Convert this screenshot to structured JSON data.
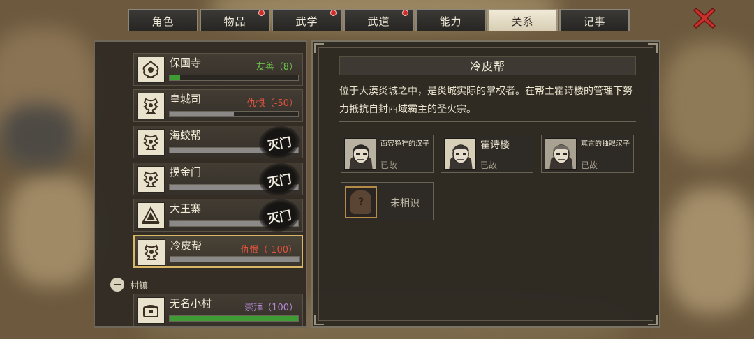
{
  "tabs": [
    {
      "label": "角色",
      "badge": false,
      "active": false
    },
    {
      "label": "物品",
      "badge": true,
      "active": false
    },
    {
      "label": "武学",
      "badge": true,
      "active": false
    },
    {
      "label": "武道",
      "badge": true,
      "active": false
    },
    {
      "label": "能力",
      "badge": false,
      "active": false
    },
    {
      "label": "关系",
      "badge": false,
      "active": true
    },
    {
      "label": "记事",
      "badge": false,
      "active": false
    }
  ],
  "factions": [
    {
      "name": "保国寺",
      "status": "友善（8）",
      "status_color": "#6cbf4a",
      "bar_fill": 0.08,
      "bar_color": "#3f9b34",
      "destroyed": false,
      "selected": false
    },
    {
      "name": "皇城司",
      "status": "仇恨（-50）",
      "status_color": "#e0533f",
      "bar_fill": 0.5,
      "bar_color": "#8b8a88",
      "destroyed": false,
      "selected": false
    },
    {
      "name": "海蛟帮",
      "status": "",
      "status_color": "#e0533f",
      "bar_fill": 1.0,
      "bar_color": "#8b8a88",
      "destroyed": true,
      "selected": false
    },
    {
      "name": "摸金门",
      "status": "",
      "status_color": "#e0533f",
      "bar_fill": 1.0,
      "bar_color": "#8b8a88",
      "destroyed": true,
      "selected": false
    },
    {
      "name": "大王寨",
      "status": "",
      "status_color": "#e0533f",
      "bar_fill": 1.0,
      "bar_color": "#8b8a88",
      "destroyed": true,
      "selected": false
    },
    {
      "name": "冷皮帮",
      "status": "仇恨（-100）",
      "status_color": "#e0533f",
      "bar_fill": 1.0,
      "bar_color": "#8b8a88",
      "destroyed": false,
      "selected": true
    }
  ],
  "destroyed_stamp": "灭门",
  "section": {
    "label": "村镇"
  },
  "village": {
    "name": "无名小村",
    "status": "崇拜（100）",
    "status_color": "#b58ad8",
    "bar_fill": 1.0,
    "bar_color": "#3f9b34"
  },
  "detail": {
    "title": "冷皮帮",
    "description": "位于大漠炎城之中，是炎城实际的掌权者。在帮主霍诗楼的管理下努力抵抗自封西域霸主的圣火宗。",
    "members": [
      {
        "name": "面容狰狞的汉子",
        "state": "已故",
        "big": false
      },
      {
        "name": "霍诗楼",
        "state": "已故",
        "big": true
      },
      {
        "name": "寡言的独眼汉子",
        "state": "已故",
        "big": false
      }
    ],
    "unknown": {
      "label": "未相识",
      "mark": "?"
    }
  },
  "colors": {
    "accent": "#d8b866",
    "close": "#c9302c"
  }
}
